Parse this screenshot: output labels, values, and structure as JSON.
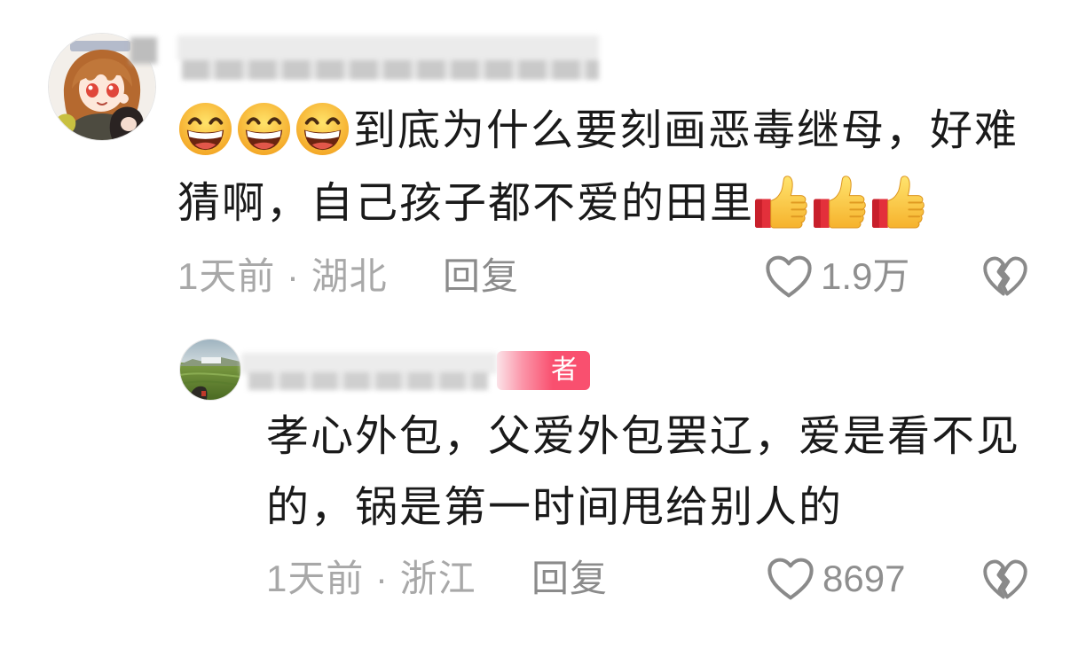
{
  "colors": {
    "text": "#1a1a1a",
    "meta": "#a8a8a8",
    "reply_label": "#8b8b8b",
    "icon": "#8a8a8a",
    "count": "#8f8f8f",
    "author_badge": "#f9506f"
  },
  "comment": {
    "avatar_icon": "anime-character-avatar",
    "leading_emojis": [
      "grin-face",
      "grin-face",
      "grin-face"
    ],
    "text": "到底为什么要刻画恶毒继母，好难猜啊，自己孩子都不爱的田里",
    "trailing_emojis": [
      "thumbs-up",
      "thumbs-up",
      "thumbs-up"
    ],
    "time_location": "1天前 · 湖北",
    "reply_label": "回复",
    "like_icon": "heart-outline",
    "like_count": "1.9万",
    "dislike_icon": "broken-heart"
  },
  "reply": {
    "avatar_icon": "landscape-avatar",
    "badge": "者",
    "text": "孝心外包，父爱外包罢辽，爱是看不见的，锅是第一时间甩给别人的",
    "time_location": "1天前 · 浙江",
    "reply_label": "回复",
    "like_icon": "heart-outline",
    "like_count": "8697",
    "dislike_icon": "broken-heart"
  }
}
